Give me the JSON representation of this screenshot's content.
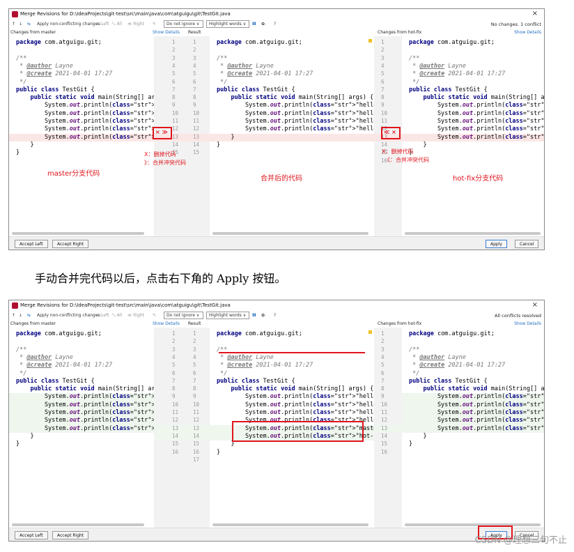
{
  "shared": {
    "title": "Merge Revisions for D:\\IdeaProjects\\git-test\\src\\main\\java\\com\\atguigu\\git\\TestGit.java",
    "close": "×",
    "toolbar": {
      "up": "↑",
      "down": "↓",
      "apply_icon": "⇆",
      "apply_nc": "Apply non-conflicting changes:",
      "left": "≫ Left",
      "all": "⁰ₐ All",
      "right": "≪ Right",
      "pencil": "✎",
      "ignore": "Do not ignore ∨",
      "highlight": "Highlight words ∨",
      "cols": "Ⅲ",
      "gear": "✿.",
      "help": "?"
    },
    "labels": {
      "left": "Changes from master",
      "show1": "Show Details",
      "result": "Result",
      "right": "Changes from hot-fix",
      "show2": "Show Details"
    },
    "buttons": {
      "accept_left": "Accept Left",
      "accept_right": "Accept Right",
      "apply": "Apply",
      "cancel": "Cancel"
    },
    "accent": "#e0141c"
  },
  "w1": {
    "status": "No changes. 1 conflict",
    "left_code": [
      "package com.atguigu.git;",
      "",
      "/**",
      " * @author Layne",
      " * @create 2021-04-01 17:27",
      " */",
      "public class TestGit {",
      "    public static void main(String[] arg",
      "        System.out.println(\"hello git!\")",
      "        System.out.println(\"hello git2!\"",
      "        System.out.println(\"hello git3!\"",
      "        System.out.println(\"hello git4!\"",
      "        System.out.println(\"master test!",
      "    }",
      "}"
    ],
    "result_code": [
      "package com.atguigu.git;",
      "",
      "/**",
      " * @author Layne",
      " * @create 2021-04-01 17:27",
      " */",
      "public class TestGit {",
      "    public static void main(String[] args) {",
      "        System.out.println(\"hello git!\");",
      "        System.out.println(\"hello git2!\");",
      "        System.out.println(\"hello git3!\");",
      "        System.out.println(\"hello git4!\");",
      "    }",
      "}"
    ],
    "right_code": [
      "package com.atguigu.git;",
      "",
      "/**",
      " * @author Layne",
      " * @create 2021-04-01 17:27",
      " */",
      "public class TestGit {",
      "    public static void main(String[] args",
      "        System.out.println(\"hello git!\");",
      "        System.out.println(\"hello git2!\");",
      "        System.out.println(\"hello git3!\");",
      "        System.out.println(\"hello git4!\");",
      "        System.out.println(\"hot-fix test!",
      "    }",
      "}"
    ],
    "gutter_left": [
      "1",
      "2",
      "3",
      "4",
      "5",
      "6",
      "7",
      "8",
      "9",
      "10",
      "11",
      "12",
      "13",
      "14",
      "15"
    ],
    "gutter_res": [
      "1",
      "2",
      "3",
      "4",
      "5",
      "6",
      "7",
      "8",
      "9",
      "10",
      "11",
      "12",
      "13",
      "14",
      "15"
    ],
    "gutter_right": [
      "1",
      "2",
      "3",
      "4",
      "5",
      "6",
      "7",
      "8",
      "9",
      "10",
      "11",
      "12",
      "13",
      "14",
      "15",
      "16"
    ],
    "arrow_left": "× ≫",
    "arrow_right": "≪ ×",
    "ann_left_1": "X：删掉代码",
    "ann_left_2": "》：合并冲突代码",
    "ann_right_1": "X：删掉代码",
    "ann_right_2": "《：合并冲突代码",
    "lbl_master": "master分支代码",
    "lbl_merged": "合并后的代码",
    "lbl_hotfix": "hot-fix分支代码"
  },
  "caption": "手动合并完代码以后，点击右下角的 Apply 按钮。",
  "w2": {
    "status": "All conflicts resolved",
    "left_code": [
      "package com.atguigu.git;",
      "",
      "/**",
      " * @author Layne",
      " * @create 2021-04-01 17:27",
      " */",
      "public class TestGit {",
      "    public static void main(String[] arg",
      "        System.out.println(\"hello git!\")",
      "        System.out.println(\"hello git2!\"",
      "        System.out.println(\"hello git3!\"",
      "        System.out.println(\"hello git4!\"",
      "        System.out.println(\"master test!",
      "    }",
      "}"
    ],
    "result_code": [
      "package com.atguigu.git;",
      "",
      "/**",
      " * @author Layne",
      " * @create 2021-04-01 17:27",
      " */",
      "public class TestGit {",
      "    public static void main(String[] args) {",
      "        System.out.println(\"hello git!\");",
      "        System.out.println(\"hello git2!\");",
      "        System.out.println(\"hello git3!\");",
      "        System.out.println(\"hello git4!\");",
      "        System.out.println(\"master test!\");",
      "        System.out.println(\"hot-fix test!\");",
      "    }",
      "}"
    ],
    "right_code": [
      "package com.atguigu.git;",
      "",
      "/**",
      " * @author Layne",
      " * @create 2021-04-01 17:27",
      " */",
      "public class TestGit {",
      "    public static void main(String[] args",
      "        System.out.println(\"hello git!\");",
      "        System.out.println(\"hello git2!\");",
      "        System.out.println(\"hello git3!\");",
      "        System.out.println(\"hello git4!\");",
      "        System.out.println(\"hot-fix test!",
      "    }",
      "}"
    ],
    "gutter_left": [
      "1",
      "2",
      "3",
      "4",
      "5",
      "6",
      "7",
      "8",
      "9",
      "10",
      "11",
      "12",
      "13",
      "14",
      "15",
      "16"
    ],
    "gutter_res": [
      "1",
      "2",
      "3",
      "4",
      "5",
      "6",
      "7",
      "8",
      "9",
      "10",
      "11",
      "12",
      "13",
      "14",
      "15",
      "16",
      "17"
    ],
    "gutter_right": [
      "1",
      "2",
      "3",
      "4",
      "5",
      "6",
      "7",
      "8",
      "9",
      "10",
      "11",
      "12",
      "13",
      "14",
      "15",
      "16"
    ]
  },
  "watermark": "CSDN @理想三旬不止"
}
